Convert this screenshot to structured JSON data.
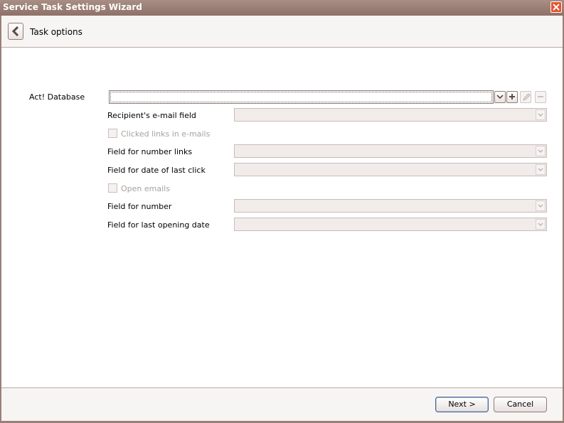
{
  "window": {
    "title": "Service Task Settings Wizard"
  },
  "header": {
    "title": "Task options"
  },
  "form": {
    "database_label": "Act! Database",
    "database_value": "",
    "recipient_email_label": "Recipient's e-mail field",
    "clicked_links_label": "Clicked links in e-mails",
    "field_number_links_label": "Field for number links",
    "field_date_last_click_label": "Field for date of last click",
    "open_emails_label": "Open emails",
    "field_number_label": "Field for number",
    "field_last_opening_label": "Field for last opening date"
  },
  "footer": {
    "next_label": "Next >",
    "cancel_label": "Cancel"
  },
  "colors": {
    "titlebar": "#8e7168",
    "close": "#e8512f",
    "frame": "#9a7f76"
  }
}
